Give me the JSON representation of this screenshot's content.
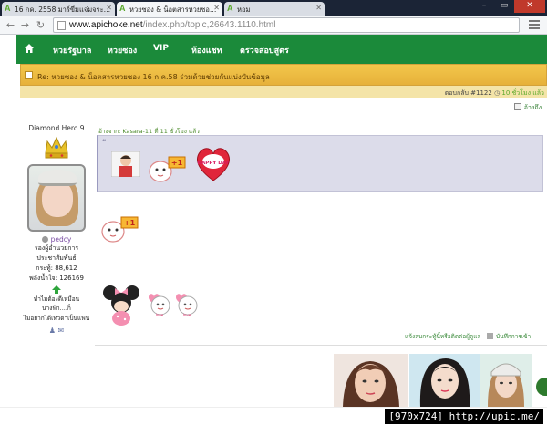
{
  "browser": {
    "tabs": [
      {
        "title": "16 กค. 2558 มาร์ขี่มแจ่มจระ…",
        "active": false
      },
      {
        "title": "หวยซอง & น็อตสารหวยซอ…",
        "active": true
      },
      {
        "title": "หอม",
        "active": false
      }
    ],
    "url_host": "www.apichoke.net",
    "url_path": "/index.php/topic,26643.1110.html"
  },
  "site_nav": {
    "items": [
      "หวยรัฐบาล",
      "หวยซอง",
      "VIP",
      "ห้องแชท",
      "ตรวจสอบสูตร"
    ]
  },
  "topic": {
    "title": "Re: หวยซอง & น็อตสารหวยซอง 16 ก.ค.58 ร่วมด้วยช่วยกันแบ่งปันข้อมูล"
  },
  "reply": {
    "number": "ตอบกลับ #1122",
    "since": "10 ชั่วโมง แล้ว",
    "quote_label": "อ้างถึง"
  },
  "author": {
    "rank": "Diamond Hero 9",
    "username": "pedcy",
    "stat_line1": "รองผู้อำนวยการประชาสัมพันธ์",
    "stat_line2": "กระทู้: 88,612",
    "stat_line3": "พลังน้ำใจ: 126169",
    "sig_line1": "ทำไมต้องดีเหมือนนางฟ้า....ก็",
    "sig_line2": "ไม่อยากได้เทวดาเป็นแฟน"
  },
  "post": {
    "quote_header": "อ้างจาก: Kasara-11 ที่ 11 ชั่วโมง แล้ว",
    "quote_mark": "❝",
    "sticker_plus": "+1",
    "sticker_heart_text": "HAPPY DAY",
    "report_link": "แจ้งลบกระทู้นี้หรือติดต่อผู้ดูแล",
    "ip_link": "บันทึกการเข้า"
  },
  "watermark": "[970x724] http://upic.me/"
}
